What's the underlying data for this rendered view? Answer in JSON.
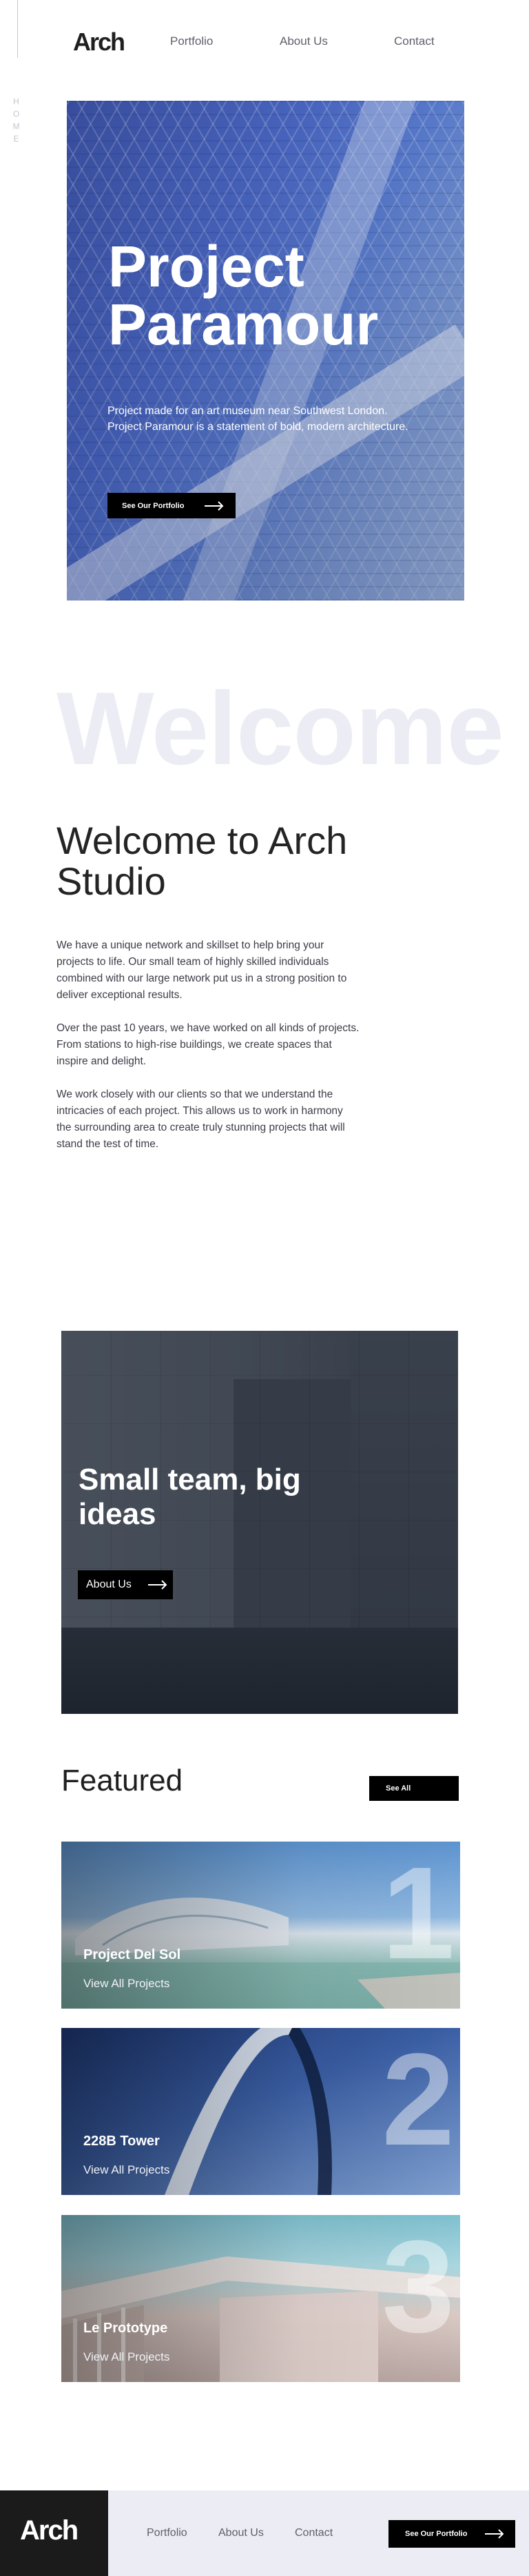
{
  "header": {
    "logo": "Arch",
    "nav": {
      "portfolio": "Portfolio",
      "about": "About Us",
      "contact": "Contact"
    }
  },
  "side_label": "HOME",
  "hero": {
    "title": "Project Paramour",
    "description": "Project made for an art museum near Southwest London. Project Paramour is a statement of bold, modern architecture.",
    "button_label": "See Our Portfolio"
  },
  "welcome": {
    "background_word": "Welcome",
    "title": "Welcome to Arch Studio",
    "paragraphs": [
      "We have a unique network and skillset to help bring your projects to life. Our small team of highly skilled individuals combined with our large network put us in a strong position to deliver exceptional results.",
      "Over the past 10 years, we have worked on all kinds of projects. From stations to high-rise buildings, we create spaces that inspire and delight.",
      "We work closely with our clients so that we understand the intricacies of each project. This allows us to work in harmony the surrounding area to create truly stunning projects that will stand the test of time."
    ]
  },
  "team": {
    "title": "Small team, big ideas",
    "button_label": "About Us"
  },
  "featured": {
    "title": "Featured",
    "see_all_label": "See All",
    "projects": [
      {
        "number": "1",
        "name": "Project Del Sol",
        "link": "View All Projects"
      },
      {
        "number": "2",
        "name": "228B Tower",
        "link": "View All Projects"
      },
      {
        "number": "3",
        "name": "Le Prototype",
        "link": "View All Projects"
      }
    ]
  },
  "footer": {
    "logo": "Arch",
    "nav": {
      "portfolio": "Portfolio",
      "about": "About Us",
      "contact": "Contact"
    },
    "button_label": "See Our Portfolio"
  },
  "colors": {
    "ink": "#1f1f1f",
    "muted": "#5f5f6d",
    "pale": "#ecedf4",
    "button": "#000000"
  }
}
